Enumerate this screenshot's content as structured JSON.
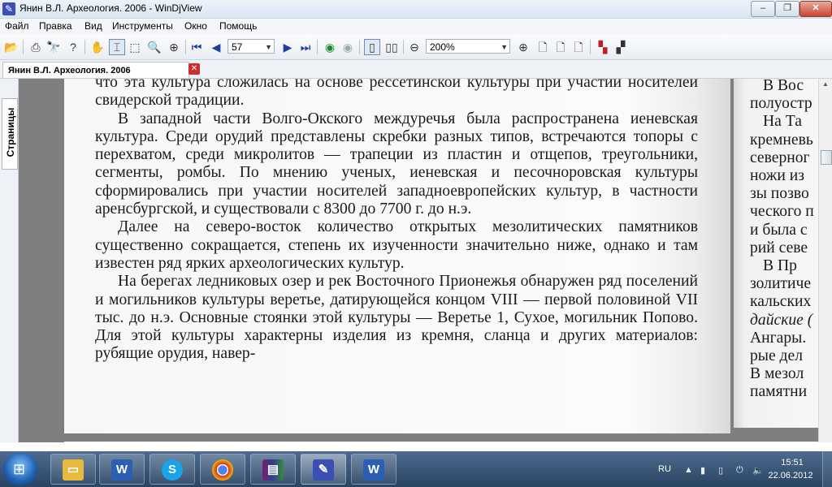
{
  "window": {
    "title": "Янин В.Л. Археология. 2006 - WinDjView",
    "min_glyph": "–",
    "max_glyph": "❐",
    "close_glyph": "✕"
  },
  "menu": [
    "Файл",
    "Правка",
    "Вид",
    "Инструменты",
    "Окно",
    "Помощь"
  ],
  "toolbar": {
    "page_number": "57",
    "zoom": "200%"
  },
  "tabs": {
    "document_tab": "Янин В.Л. Археология. 2006",
    "close_glyph": "✕",
    "sidebar_tab": "Страницы"
  },
  "page": {
    "paragraphs": [
      "что эта культура сложилась на основе рессетинской культуры при участии носителей свидерской традиции.",
      "В западной части Волго-Окского междуречья была распространена иеневская культура. Среди орудий представлены скребки разных типов, встречаются топоры с перехватом, среди микролитов — трапеции из пластин и отщепов, треугольники, сегменты, ромбы. По мнению ученых, иеневская и песочноровская культуры сформировались при участии носителей западноевропейских культур, в частности аренсбургской, и существовали с 8300 до 7700 г. до н.э.",
      "Далее на северо-восток количество открытых мезолитических памятников существенно сокращается, степень их изученности значительно ниже, однако и там известен ряд ярких археологических культур.",
      "На берегах ледниковых озер и рек Восточного Прионежья обнаружен ряд поселений и могильников культуры веретье, датирующейся концом VIII — первой половиной VII тыс. до н.э. Основные стоянки этой культуры — Веретье 1, Сухое, могильник Попово. Для этой культуры характерны изделия из кремня, сланца и других материалов: рубящие орудия, навер-"
    ],
    "right_lines": [
      "В Вос",
      "полуостр",
      "На Та",
      "кремневь",
      "северног",
      "ножи из",
      "зы позво",
      "ческого п",
      "и была с",
      "рий севе",
      "В Пр",
      "золитиче",
      "кальских",
      "дайские (",
      "Ангары.",
      "рые дел",
      "В мезол",
      "памятни"
    ]
  },
  "taskbar": {
    "lang": "RU",
    "time": "15:51",
    "date": "22.06.2012"
  }
}
